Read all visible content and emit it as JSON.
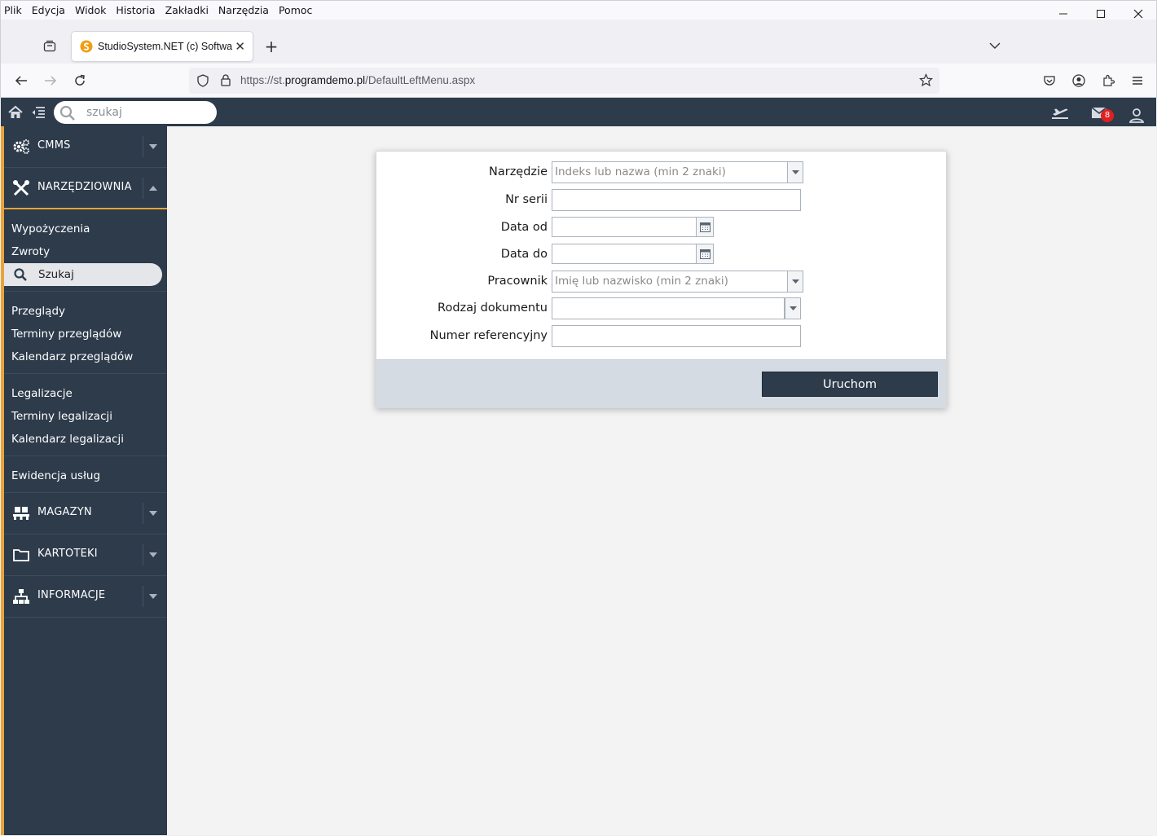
{
  "browser": {
    "menu": [
      "Plik",
      "Edycja",
      "Widok",
      "Historia",
      "Zakładki",
      "Narzędzia",
      "Pomoc"
    ],
    "tab_title": "StudioSystem.NET (c) Software Studio",
    "url_prefix": "https://st.",
    "url_domain": "programdemo.pl",
    "url_path": "/DefaultLeftMenu.aspx"
  },
  "header": {
    "search_placeholder": "szukaj",
    "mail_count": "8"
  },
  "sidebar": {
    "sections": [
      {
        "label": "CMMS"
      },
      {
        "label": "NARZĘDZIOWNIA"
      },
      {
        "label": "MAGAZYN"
      },
      {
        "label": "KARTOTEKI"
      },
      {
        "label": "INFORMACJE"
      }
    ],
    "groups": [
      [
        "Wypożyczenia",
        "Zwroty",
        "Szukaj"
      ],
      [
        "Przeglądy",
        "Terminy przeglądów",
        "Kalendarz przeglądów"
      ],
      [
        "Legalizacje",
        "Terminy legalizacji",
        "Kalendarz legalizacji"
      ],
      [
        "Ewidencja usług"
      ]
    ]
  },
  "form": {
    "fields": [
      {
        "label": "Narzędzie",
        "placeholder": "Indeks lub nazwa (min 2 znaki)"
      },
      {
        "label": "Nr serii",
        "value": ""
      },
      {
        "label": "Data od",
        "value": ""
      },
      {
        "label": "Data do",
        "value": ""
      },
      {
        "label": "Pracownik",
        "placeholder": "Imię lub nazwisko (min 2 znaki)"
      },
      {
        "label": "Rodzaj dokumentu",
        "value": ""
      },
      {
        "label": "Numer referencyjny",
        "value": ""
      }
    ],
    "run_label": "Uruchom"
  },
  "colors": {
    "nav_bg": "#2d3b4b",
    "accent": "#e8a43a",
    "badge": "#e02020"
  }
}
